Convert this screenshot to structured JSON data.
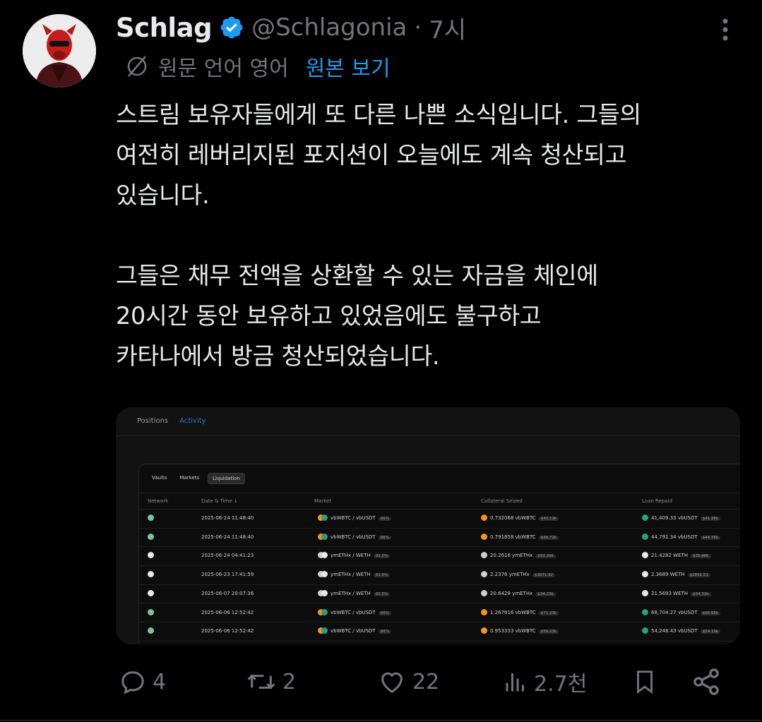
{
  "author": {
    "name": "Schlag",
    "handle": "@Schlagonia",
    "dot": "·",
    "time": "7시"
  },
  "translate": {
    "label": "원문 언어 영어",
    "link": "원본 보기"
  },
  "body_text": "스트림 보유자들에게 또 다른 나쁜 소식입니다. 그들의\n여전히 레버리지된 포지션이 오늘에도 계속 청산되고\n있습니다.\n\n그들은 채무 전액을 상환할 수 있는 자금을 체인에\n20시간 동안 보유하고 있었음에도 불구하고\n카타나에서 방금 청산되었습니다.",
  "media": {
    "tabs": [
      "Positions",
      "Activity"
    ],
    "active_tab": "Activity",
    "pills": [
      "Vaults",
      "Markets",
      "Liquidation"
    ],
    "active_pill": "Liquidation",
    "columns": [
      "Network",
      "Date & Time ↓",
      "Market",
      "Collateral Seized",
      "Loan Repaid"
    ],
    "rows": [
      {
        "date": "2025-06-24 11:48:40",
        "market": "vbWBTC / vbUSDT",
        "lltv": "86%",
        "collateral": "0.732068 vbWBTC",
        "coll_usd": "$43.19k",
        "loan": "41,409.33 vbUSDT",
        "loan_usd": "$41.38k",
        "net": "green"
      },
      {
        "date": "2025-06-24 11:48:40",
        "market": "vbWBTC / vbUSDT",
        "lltv": "86%",
        "collateral": "0.791858 vbWBTC",
        "coll_usd": "$46.72k",
        "loan": "44,791.34 vbUSDT",
        "loan_usd": "$44.78k",
        "net": "green"
      },
      {
        "date": "2025-06-24 04:41:23",
        "market": "ymETHx / WETH",
        "lltv": "91.5%",
        "collateral": "20.2616 ymETHx",
        "coll_usd": "$53.29k",
        "loan": "21.4282 WETH",
        "loan_usd": "$35.48k",
        "net": "white"
      },
      {
        "date": "2025-06-23 17:41:59",
        "market": "ymETHx / WETH",
        "lltv": "91.5%",
        "collateral": "2.2376 ymETHx",
        "coll_usd": "$3871.92",
        "loan": "2.3689 WETH",
        "loan_usd": "$2891.51",
        "net": "white"
      },
      {
        "date": "2025-06-07 20:07:36",
        "market": "ymETHx / WETH",
        "lltv": "91.5%",
        "collateral": "20.6428 ymETHx",
        "coll_usd": "$34.23k",
        "loan": "21.5693 WETH",
        "loan_usd": "$34.32k",
        "net": "white"
      },
      {
        "date": "2025-06-06 12:52:42",
        "market": "vbWBTC / vbUSDT",
        "lltv": "86%",
        "collateral": "1.267616 vbWBTC",
        "coll_usd": "$71.23k",
        "loan": "68,704.27 vbUSDT",
        "loan_usd": "$68.68k",
        "net": "green"
      },
      {
        "date": "2025-06-06 12:52:42",
        "market": "vbWBTC / vbUSDT",
        "lltv": "86%",
        "collateral": "0.953333 vbWBTC",
        "coll_usd": "$56.23k",
        "loan": "54,248.43 vbUSDT",
        "loan_usd": "$54.19k",
        "net": "green"
      }
    ]
  },
  "actions": {
    "replies": "4",
    "reposts": "2",
    "likes": "22",
    "views": "2.7천"
  },
  "colors": {
    "accent": "#1d9bf0",
    "muted": "#71767b",
    "text": "#e7e9ea"
  }
}
